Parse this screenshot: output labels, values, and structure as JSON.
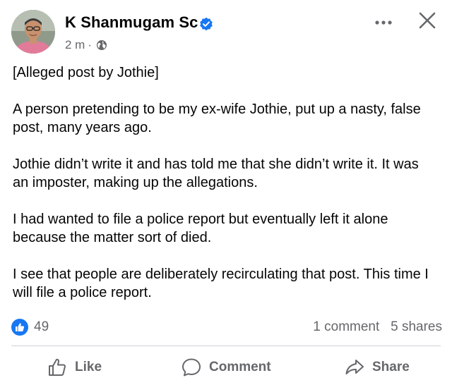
{
  "post": {
    "author": "K Shanmugam Sc",
    "time": "2 m",
    "dot": "·",
    "paragraphs": [
      "[Alleged post by Jothie]",
      "A person pretending to be my ex-wife Jothie, put up a nasty, false post, many years ago.",
      "Jothie didn’t write it and has told me that she didn’t write it. It was an imposter, making up the allegations.",
      "I had wanted to file a police report but eventually left it alone because the matter sort of died.",
      "I see that people are deliberately recirculating that post. This time I will file a police report."
    ]
  },
  "stats": {
    "likes": "49",
    "comments": "1 comment",
    "shares": "5 shares"
  },
  "actions": {
    "like": "Like",
    "comment": "Comment",
    "share": "Share"
  },
  "icons": {
    "verified": "verified-badge-icon",
    "audience": "globe-icon",
    "more": "more-options-icon",
    "close": "close-icon",
    "like_badge": "like-reaction-icon",
    "like": "thumbs-up-icon",
    "comment": "comment-bubble-icon",
    "share": "share-arrow-icon"
  },
  "colors": {
    "facebook_blue": "#1877f2",
    "secondary_text": "#65676b",
    "primary_text": "#050505",
    "divider": "#ced0d4"
  }
}
